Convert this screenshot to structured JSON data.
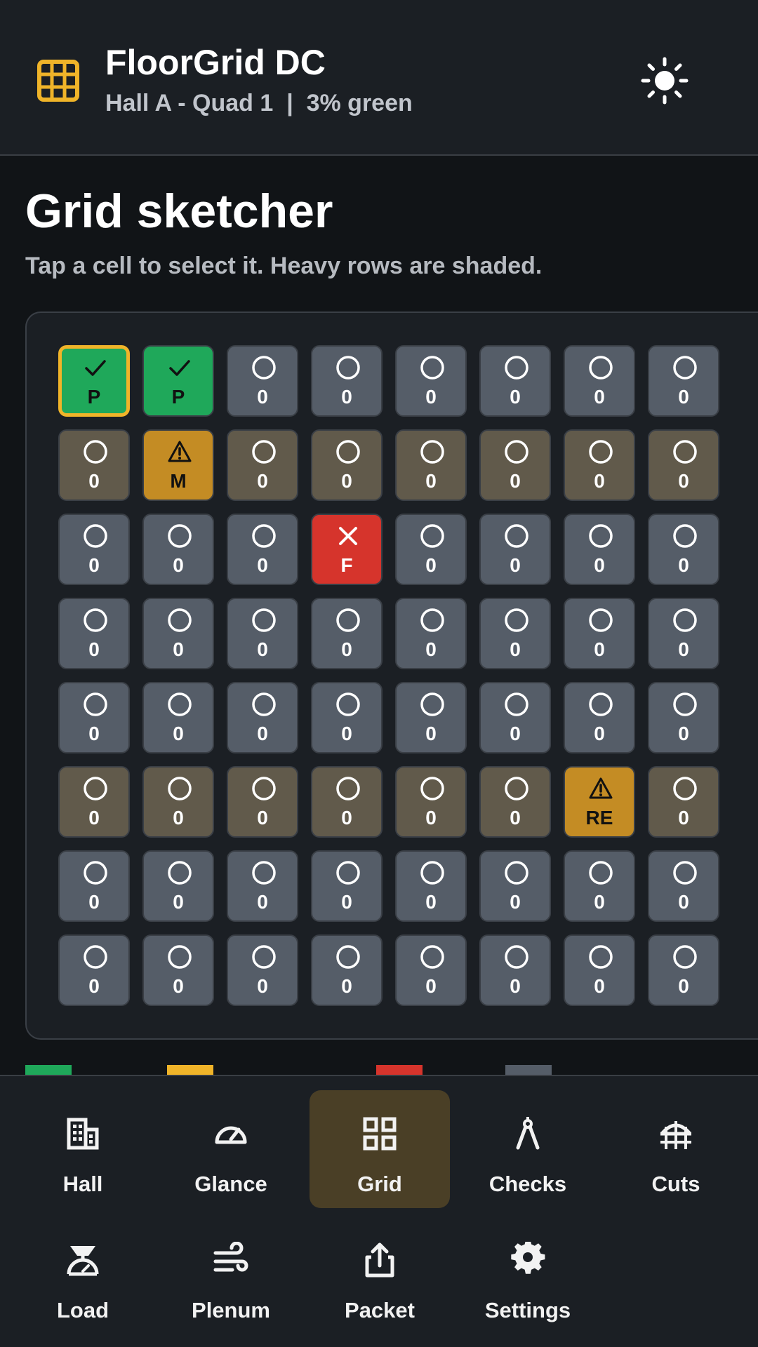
{
  "app": {
    "title": "FloorGrid DC",
    "subtitle": "Hall A - Quad 1  |  3% green",
    "logo_icon": "grid-icon",
    "theme_icon": "sun-icon",
    "accent": "#f0b429"
  },
  "page": {
    "title": "Grid sketcher",
    "hint": "Tap a cell to select it. Heavy rows are shaded."
  },
  "grid": {
    "columns": 8,
    "rows": 8,
    "heavy_rows": [
      2,
      6
    ],
    "selected": [
      1,
      1
    ],
    "cells": [
      [
        "P",
        "P",
        "0",
        "0",
        "0",
        "0",
        "0",
        "0"
      ],
      [
        "0",
        "M",
        "0",
        "0",
        "0",
        "0",
        "0",
        "0"
      ],
      [
        "0",
        "0",
        "0",
        "F",
        "0",
        "0",
        "0",
        "0"
      ],
      [
        "0",
        "0",
        "0",
        "0",
        "0",
        "0",
        "0",
        "0"
      ],
      [
        "0",
        "0",
        "0",
        "0",
        "0",
        "0",
        "0",
        "0"
      ],
      [
        "0",
        "0",
        "0",
        "0",
        "0",
        "0",
        "RE",
        "0"
      ],
      [
        "0",
        "0",
        "0",
        "0",
        "0",
        "0",
        "0",
        "0"
      ],
      [
        "0",
        "0",
        "0",
        "0",
        "0",
        "0",
        "0",
        "0"
      ]
    ],
    "status_colors": {
      "pass": "#1fa85a",
      "warn": "#c48c24",
      "fail": "#d6342c",
      "none": "#555d68",
      "heavy": "#615a4b"
    }
  },
  "legend": [
    {
      "status": "pass",
      "color": "#1fa85a"
    },
    {
      "status": "warn",
      "color": "#f0b429"
    },
    {
      "status": "fail",
      "color": "#d6342c"
    },
    {
      "status": "none",
      "color": "#555d68"
    }
  ],
  "nav": {
    "items": [
      {
        "label": "Hall",
        "icon": "building-icon",
        "active": false
      },
      {
        "label": "Glance",
        "icon": "gauge-icon",
        "active": false
      },
      {
        "label": "Grid",
        "icon": "grid-squares-icon",
        "active": true
      },
      {
        "label": "Checks",
        "icon": "compass-icon",
        "active": false
      },
      {
        "label": "Cuts",
        "icon": "floor-tile-icon",
        "active": false
      },
      {
        "label": "Load",
        "icon": "scale-icon",
        "active": false
      },
      {
        "label": "Plenum",
        "icon": "airflow-icon",
        "active": false
      },
      {
        "label": "Packet",
        "icon": "share-icon",
        "active": false
      },
      {
        "label": "Settings",
        "icon": "gear-icon",
        "active": false
      }
    ]
  }
}
